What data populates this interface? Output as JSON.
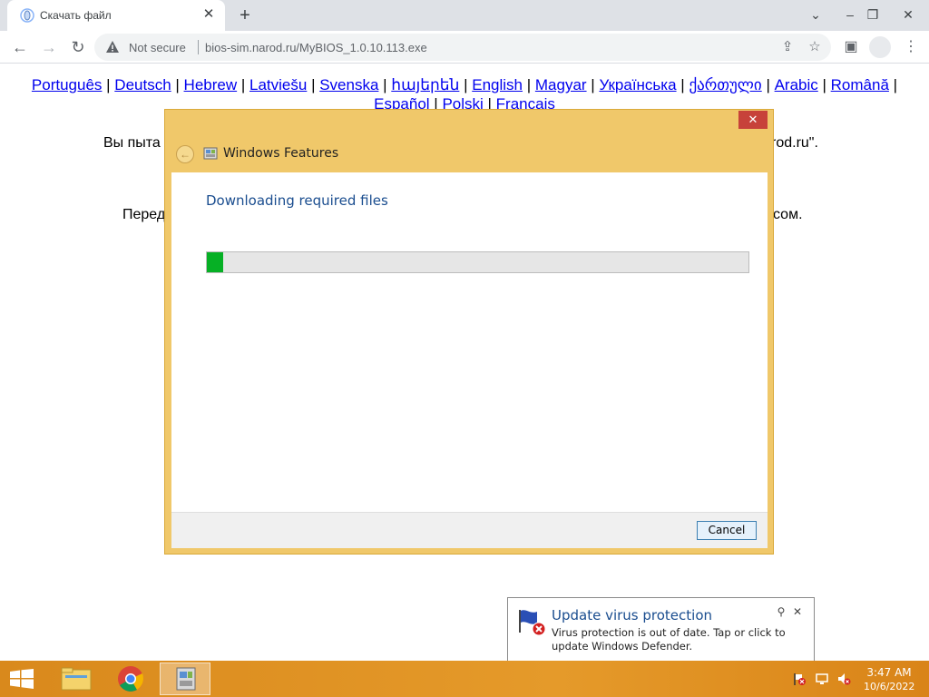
{
  "browser": {
    "tab_title": "Скачать файл",
    "security_label": "Not secure",
    "url": "bios-sim.narod.ru/MyBIOS_1.0.10.113.exe"
  },
  "page": {
    "languages": [
      "Português",
      "Deutsch",
      "Hebrew",
      "Latviešu",
      "Svenska",
      "հայերեն",
      "English",
      "Magyar",
      "Українська",
      "ქართული",
      "Arabic",
      "Română",
      "Español",
      "Polski",
      "Français"
    ],
    "separator": "|",
    "line1_start": "Вы пыта",
    "line1_end": "rod.ru\".",
    "line2_start": "Перед",
    "line2_end": "сом."
  },
  "dialog": {
    "title": "Windows Features",
    "heading": "Downloading required files",
    "progress_fraction": 0.03,
    "cancel_label": "Cancel"
  },
  "notification": {
    "title": "Update virus protection",
    "message": "Virus protection is out of date. Tap or click to update Windows Defender."
  },
  "taskbar": {
    "time": "3:47 AM",
    "date": "10/6/2022"
  },
  "colors": {
    "dialog_frame": "#f0c86a",
    "progress_fill": "#06b025",
    "taskbar": "#e59a2a",
    "link": "#0000ee"
  }
}
